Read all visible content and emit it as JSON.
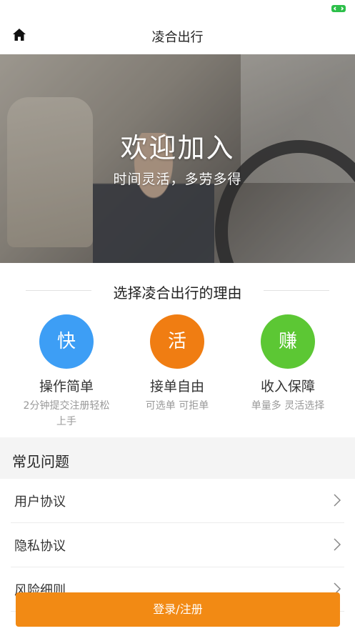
{
  "app": {
    "title": "凌合出行"
  },
  "hero": {
    "title": "欢迎加入",
    "subtitle": "时间灵活，多劳多得"
  },
  "reasons": {
    "heading": "选择凌合出行的理由",
    "items": [
      {
        "badge": "快",
        "color": "#3d9ef5",
        "title": "操作简单",
        "desc": "2分钟提交注册轻松上手"
      },
      {
        "badge": "活",
        "color": "#f07d12",
        "title": "接单自由",
        "desc": "可选单 可拒单"
      },
      {
        "badge": "赚",
        "color": "#5cc734",
        "title": "收入保障",
        "desc": "单量多 灵活选择"
      }
    ]
  },
  "faq": {
    "title": "常见问题",
    "items": [
      {
        "label": "用户协议"
      },
      {
        "label": "隐私协议"
      },
      {
        "label": "风险细则"
      }
    ]
  },
  "login_button": {
    "label": "登录/注册"
  },
  "colors": {
    "accent": "#f28a14",
    "battery": "#2dbf4a"
  }
}
